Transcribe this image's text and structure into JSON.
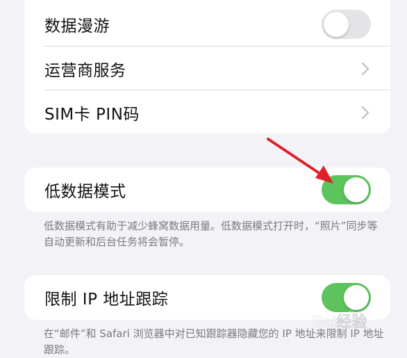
{
  "group1": {
    "roaming_label": "数据漫游",
    "roaming_on": false,
    "carrier_label": "运营商服务",
    "sim_pin_label": "SIM卡 PIN码"
  },
  "low_data": {
    "label": "低数据模式",
    "on": true,
    "note": "低数据模式有助于减少蜂窝数据用量。低数据模式打开时，“照片”同步等自动更新和后台任务将会暂停。"
  },
  "ip_tracking": {
    "label": "限制 IP 地址跟踪",
    "on": true,
    "note": "在“邮件”和 Safari 浏览器中对已知跟踪器隐藏您的 IP 地址来限制 IP 地址跟踪。"
  },
  "watermark": {
    "text": "Bai经验"
  },
  "colors": {
    "toggle_on": "#5cc35d",
    "toggle_off": "#e4e4e6",
    "arrow": "#e0202a",
    "background": "#f2f2f7"
  }
}
